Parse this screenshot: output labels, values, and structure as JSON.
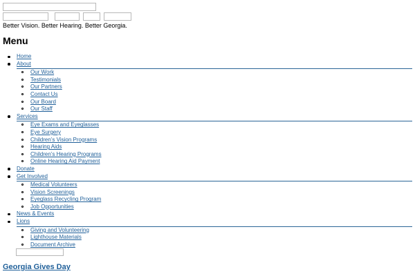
{
  "tagline": "Better Vision. Better Hearing. Better Georgia.",
  "menu_title": "Menu",
  "nav": {
    "home": "Home",
    "about": "About",
    "about_items": [
      "Our Work",
      "Testimonials",
      "Our Partners",
      "Contact Us",
      "Our Board",
      "Our Staff"
    ],
    "services": "Services",
    "services_items": [
      "Eye Exams and Eyeglasses",
      "Eye Surgery",
      "Children’s Vision Programs",
      "Hearing Aids",
      "Children’s Hearing Programs",
      "Online Hearing Aid Payment"
    ],
    "donate": "Donate",
    "get_involved": "Get Involved",
    "get_involved_items": [
      "Medical Volunteers",
      "Vision Screenings",
      "Eyeglass Recycling Program",
      "Job Opportunities"
    ],
    "news": "News & Events",
    "lions": "Lions",
    "lions_items": [
      "Giving and Volunteering",
      "Lighthouse Materials",
      "Document Archive"
    ]
  },
  "georgia_gives_day": "Georgia Gives Day",
  "colors": {
    "link": "#1f5f99",
    "divider": "#2a6496"
  }
}
